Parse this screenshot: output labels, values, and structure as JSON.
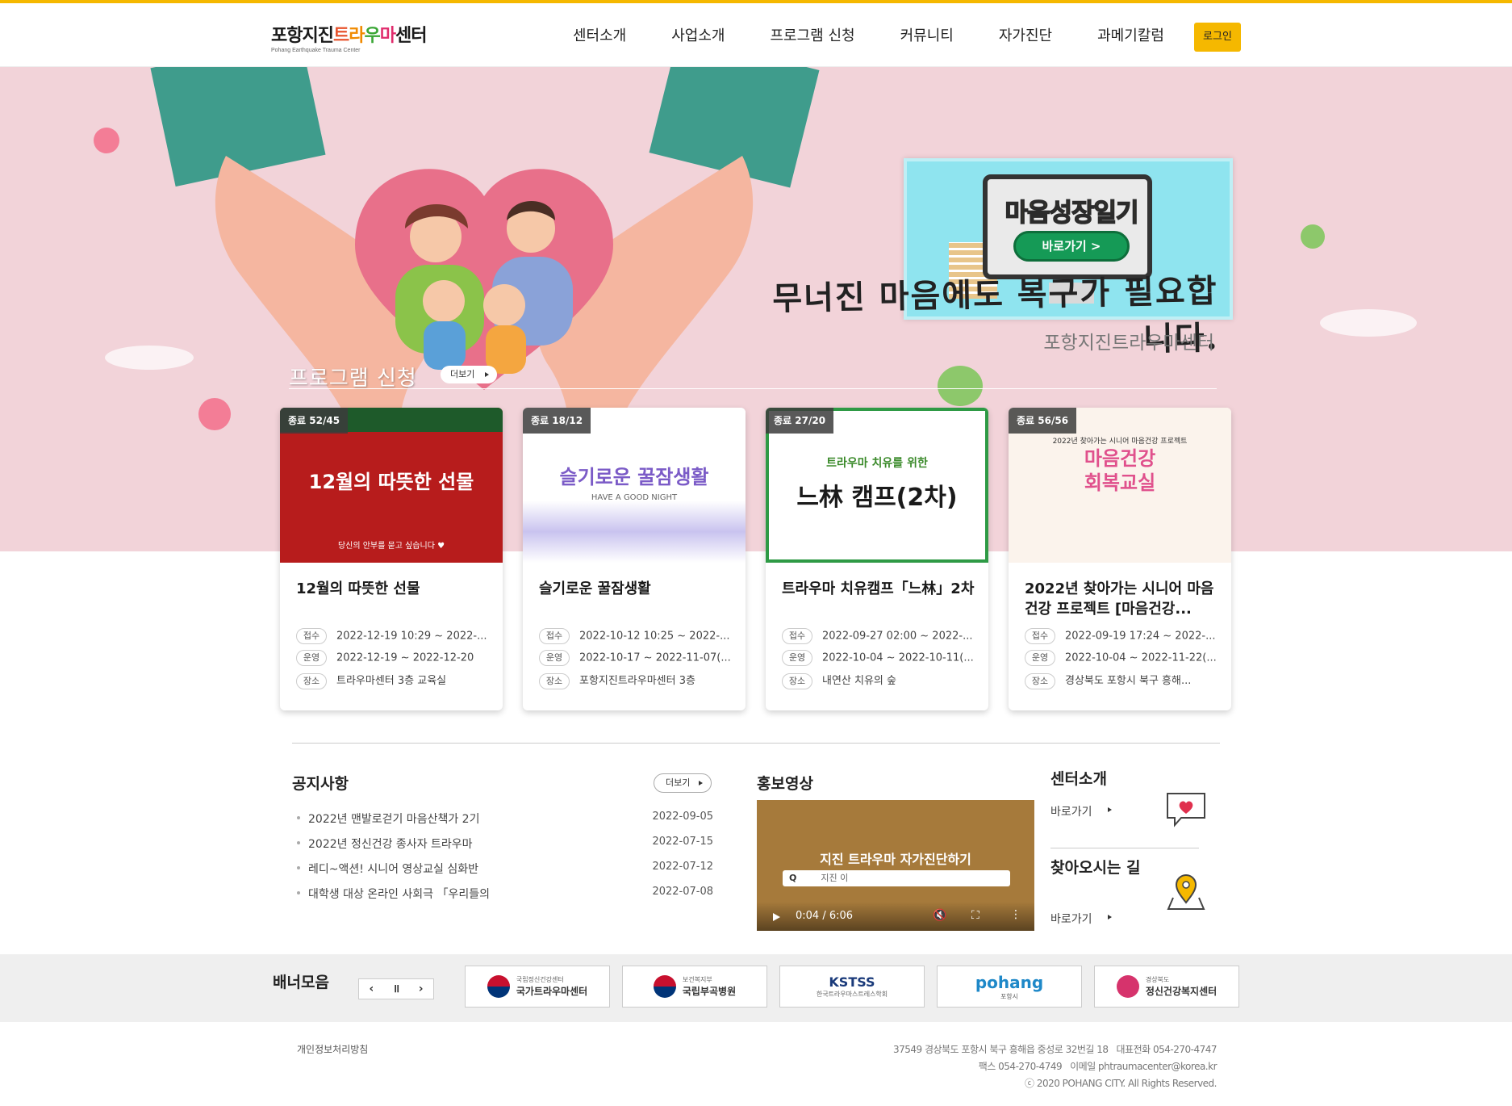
{
  "header": {
    "logo_korean": [
      "포항지진",
      "트",
      "라",
      "우",
      "마",
      "센터"
    ],
    "logo_english": "Pohang Earthquake Trauma Center",
    "nav": [
      "센터소개",
      "사업소개",
      "프로그램 신청",
      "커뮤니티",
      "자가진단",
      "과메기칼럼"
    ],
    "login_label": "로그인"
  },
  "hero": {
    "slogan": "무너진 마음에도 복구가 필요합니다.",
    "subtitle": "포항지진트라우마센터",
    "promo_title": "마음성장일기",
    "promo_button": "바로가기 >"
  },
  "programs": {
    "section_title": "프로그램 신청",
    "more_label": "더보기",
    "cards": [
      {
        "badge": "종료 52/45",
        "thumb_text": "12월의 따뜻한 선물",
        "thumb_sub": "당신의 안부를 묻고 싶습니다 ♥",
        "title": "12월의 따뜻한 선물",
        "reception": "2022-12-19 10:29 ~ 2022-...",
        "operation": "2022-12-19 ~ 2022-12-20",
        "place": "트라우마센터 3층 교육실"
      },
      {
        "badge": "종료 18/12",
        "thumb_text": "슬기로운 꿀잠생활",
        "thumb_sub": "HAVE A GOOD NIGHT",
        "title": "슬기로운 꿀잠생활",
        "reception": "2022-10-12 10:25 ~ 2022-...",
        "operation": "2022-10-17 ~ 2022-11-07(...",
        "place": "포항지진트라우마센터 3층"
      },
      {
        "badge": "종료 27/20",
        "thumb_text": "느林 캠프(2차)",
        "thumb_sub": "트라우마 치유를 위한",
        "title": "트라우마 치유캠프「느林」2차",
        "reception": "2022-09-27 02:00 ~ 2022-...",
        "operation": "2022-10-04 ~ 2022-10-11(...",
        "place": "내연산 치유의 숲"
      },
      {
        "badge": "종료 56/56",
        "thumb_text": "마음건강 회복교실",
        "thumb_sub": "2022년 찾아가는 시니어 마음건강 프로젝트",
        "title": "2022년 찾아가는 시니어 마음건강 프로젝트 [마음건강...",
        "reception": "2022-09-19 17:24 ~ 2022-...",
        "operation": "2022-10-04 ~ 2022-11-22(...",
        "place": "경상북도 포항시 북구 흥해..."
      }
    ],
    "labels": {
      "reception": "접수",
      "operation": "운영",
      "place": "장소"
    }
  },
  "notice": {
    "title": "공지사항",
    "more_label": "더보기",
    "items": [
      {
        "text": "2022년 맨발로걷기 마음산책가 2기",
        "date": "2022-09-05"
      },
      {
        "text": "2022년 정신건강 종사자 트라우마",
        "date": "2022-07-15"
      },
      {
        "text": "레디~액션! 시니어 영상교실 심화반",
        "date": "2022-07-12"
      },
      {
        "text": "대학생 대상 온라인 사회극 「우리들의",
        "date": "2022-07-08"
      }
    ]
  },
  "video": {
    "title": "홍보영상",
    "video_text": "지진 트라우마 자가진단하기",
    "search_q": "Q",
    "search_text": "지진 이",
    "time": "0:04 / 6:06"
  },
  "side": {
    "about_title": "센터소개",
    "about_link": "바로가기",
    "map_title": "찾아오시는 길",
    "map_link": "바로가기"
  },
  "banners": {
    "label": "배너모음",
    "controls": [
      "‹",
      "॥",
      "›"
    ],
    "items": [
      {
        "small": "국립정신건강센터",
        "name": "국가트라우마센터"
      },
      {
        "small": "보건복지부",
        "name": "국립부곡병원"
      },
      {
        "small": "한국트라우마스트레스학회",
        "name": "KSTSS"
      },
      {
        "small": "포항시",
        "name": "pohang"
      },
      {
        "small": "경상북도",
        "name": "정신건강복지센터"
      }
    ]
  },
  "footer": {
    "privacy": "개인정보처리방침",
    "address": "37549 경상북도 포항시 북구 흥해읍 중성로 32번길 18",
    "phone": "대표전화 054-270-4747",
    "fax": "팩스 054-270-4749",
    "email": "이메일 phtraumacenter@korea.kr",
    "copyright": "ⓒ 2020 POHANG CITY. All Rights Reserved."
  },
  "colors": {
    "accent": "#f5b800",
    "hero_bg": "#f2d3d9",
    "teal": "#3f9c8c"
  }
}
